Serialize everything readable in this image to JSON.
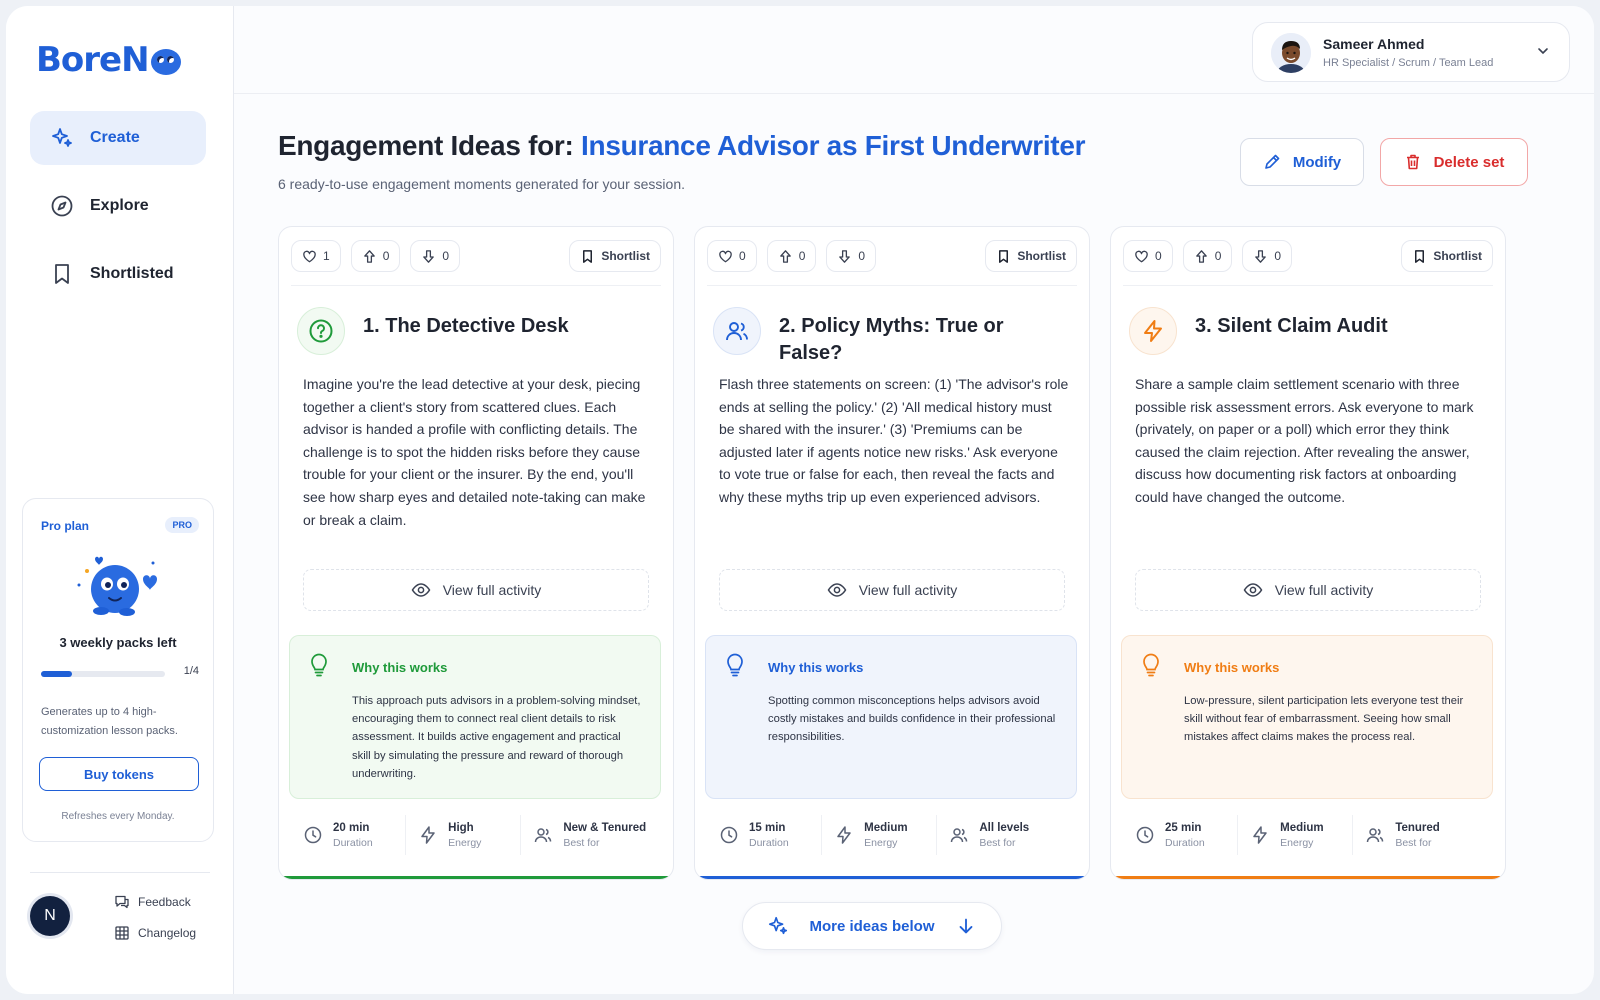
{
  "brand": {
    "name": "BoreN",
    "color": "#1f5fd6"
  },
  "nav": [
    {
      "label": "Create",
      "icon": "sparkle-icon",
      "active": true
    },
    {
      "label": "Explore",
      "icon": "compass-icon",
      "active": false
    },
    {
      "label": "Shortlisted",
      "icon": "bookmark-icon",
      "active": false
    }
  ],
  "plan": {
    "title": "Pro plan",
    "badge": "PRO",
    "packs_left": "3 weekly packs left",
    "progress_label": "1/4",
    "progress_fraction": 0.25,
    "description": "Generates up to 4 high-customization lesson packs.",
    "buy_label": "Buy tokens",
    "refresh_note": "Refreshes every Monday."
  },
  "footer": {
    "avatar_initial": "N",
    "feedback_label": "Feedback",
    "changelog_label": "Changelog"
  },
  "user": {
    "name": "Sameer Ahmed",
    "role": "HR Specialist / Scrum / Team Lead"
  },
  "page": {
    "title_prefix": "Engagement Ideas for:",
    "title_topic": "Insurance Advisor as First Underwriter",
    "subtitle": "6 ready-to-use engagement moments generated for your session.",
    "modify_label": "Modify",
    "delete_label": "Delete set"
  },
  "cards": [
    {
      "likes": "1",
      "upvotes": "0",
      "downvotes": "0",
      "shortlist_label": "Shortlist",
      "icon": "question-circle-icon",
      "accent": "#1f9a3a",
      "tint": "#f2faf2",
      "tint_border": "#d8efd9",
      "title": "1. The Detective Desk",
      "body": "Imagine you're the lead detective at your desk, piecing together a client's story from scattered clues. Each advisor is handed a profile with conflicting details. The challenge is to spot the hidden risks before they cause trouble for your client or the insurer. By the end, you'll see how sharp eyes and detailed note-taking can make or break a claim.",
      "view_label": "View full activity",
      "why_title": "Why this works",
      "why_text": "This approach puts advisors in a problem-solving mindset, encouraging them to connect real client details to risk assessment. It builds active engagement and practical skill by simulating the pressure and reward of thorough underwriting.",
      "duration": "20 min",
      "duration_label": "Duration",
      "energy": "High",
      "energy_label": "Energy",
      "best_for": "New & Tenured",
      "best_for_label": "Best for"
    },
    {
      "likes": "0",
      "upvotes": "0",
      "downvotes": "0",
      "shortlist_label": "Shortlist",
      "icon": "users-icon",
      "accent": "#1f5fd6",
      "tint": "#f0f4fc",
      "tint_border": "#d9e3f6",
      "title": "2. Policy Myths: True or False?",
      "body": "Flash three statements on screen: (1) 'The advisor's role ends at selling the policy.' (2) 'All medical history must be shared with the insurer.' (3) 'Premiums can be adjusted later if agents notice new risks.' Ask everyone to vote true or false for each, then reveal the facts and why these myths trip up even experienced advisors.",
      "view_label": "View full activity",
      "why_title": "Why this works",
      "why_text": "Spotting common misconceptions helps advisors avoid costly mistakes and builds confidence in their professional responsibilities.",
      "duration": "15 min",
      "duration_label": "Duration",
      "energy": "Medium",
      "energy_label": "Energy",
      "best_for": "All levels",
      "best_for_label": "Best for"
    },
    {
      "likes": "0",
      "upvotes": "0",
      "downvotes": "0",
      "shortlist_label": "Shortlist",
      "icon": "lightning-icon",
      "accent": "#f07d14",
      "tint": "#fef6ee",
      "tint_border": "#f8e3cf",
      "title": "3. Silent Claim Audit",
      "body": "Share a sample claim settlement scenario with three possible risk assessment errors. Ask everyone to mark (privately, on paper or a poll) which error they think caused the claim rejection. After revealing the answer, discuss how documenting risk factors at onboarding could have changed the outcome.",
      "view_label": "View full activity",
      "why_title": "Why this works",
      "why_text": "Low-pressure, silent participation lets everyone test their skill without fear of embarrassment. Seeing how small mistakes affect claims makes the process real.",
      "duration": "25 min",
      "duration_label": "Duration",
      "energy": "Medium",
      "energy_label": "Energy",
      "best_for": "Tenured",
      "best_for_label": "Best for"
    }
  ],
  "more_ideas_label": "More ideas below"
}
